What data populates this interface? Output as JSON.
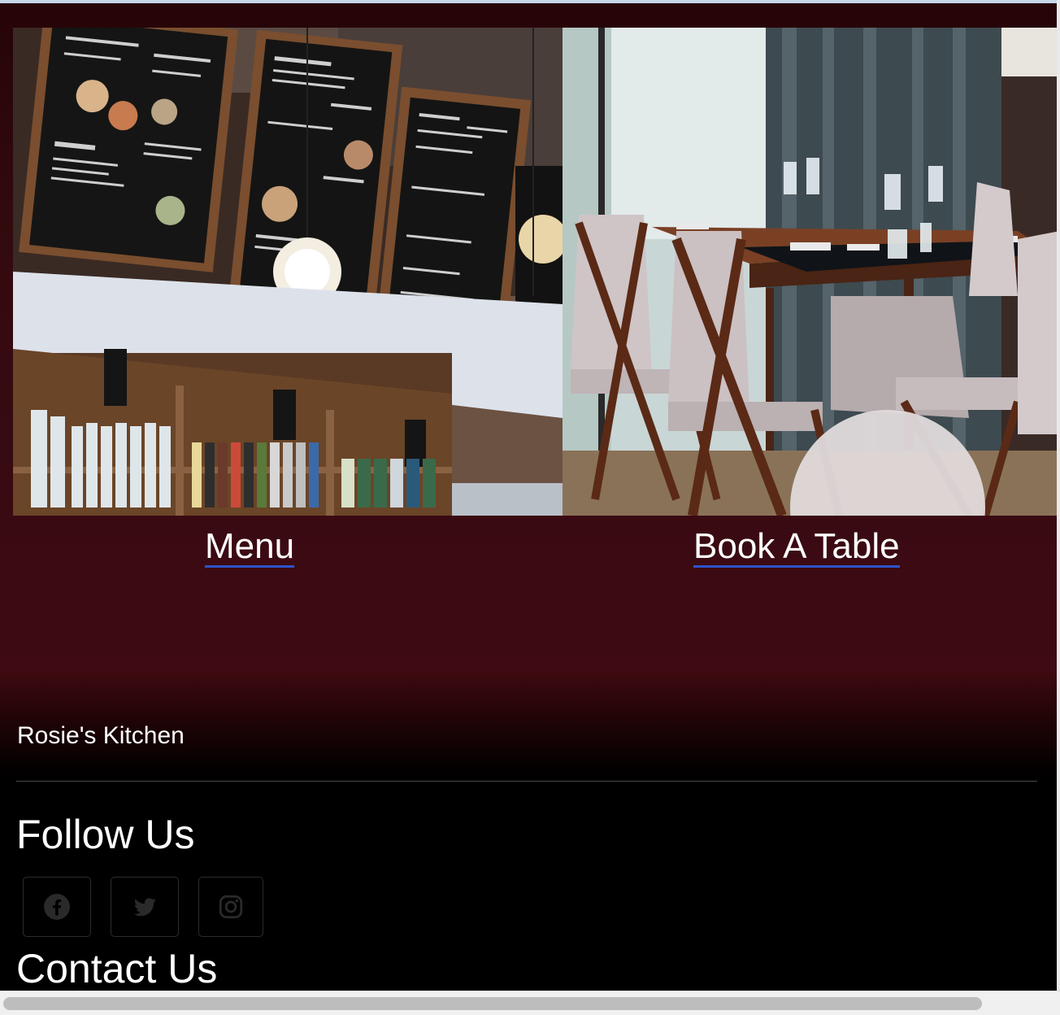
{
  "cards": {
    "menu_label": "Menu",
    "book_label": "Book A Table"
  },
  "footer": {
    "brand": "Rosie's Kitchen",
    "follow_heading": "Follow Us",
    "social": [
      {
        "icon": "facebook-icon"
      },
      {
        "icon": "twitter-icon"
      },
      {
        "icon": "instagram-icon"
      }
    ],
    "contact_heading": "Contact Us"
  },
  "colors": {
    "background_top": "#2a0508",
    "background_bottom": "#000000",
    "link_underline": "#2d54c9",
    "text": "#ffffff"
  }
}
